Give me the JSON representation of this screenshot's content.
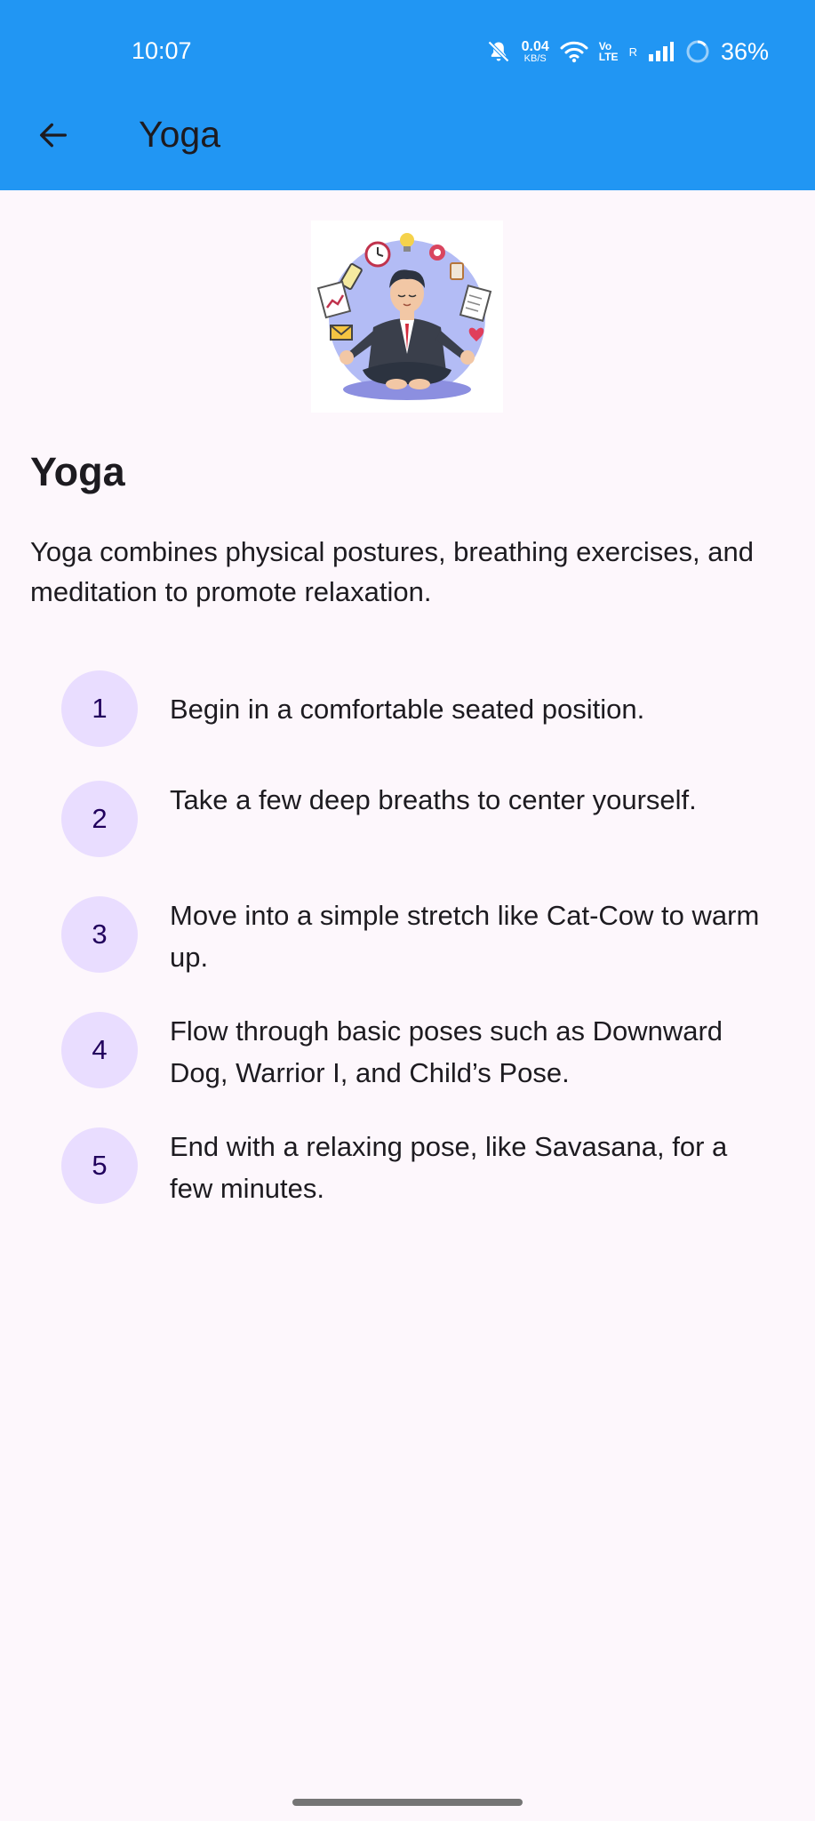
{
  "status_bar": {
    "time": "10:07",
    "net_speed_value": "0.04",
    "net_speed_unit": "KB/S",
    "volte_top": "Vo",
    "volte_bottom": "LTE",
    "roaming": "R",
    "battery": "36%",
    "icons": [
      "mute-bell-icon",
      "wifi-icon",
      "signal-icon",
      "battery-icon"
    ]
  },
  "app_bar": {
    "title": "Yoga",
    "color": "#2196f3",
    "back_icon": "arrow-left-icon"
  },
  "content": {
    "heading": "Yoga",
    "description": "Yoga combines physical postures, breathing exercises, and meditation to promote relaxation.",
    "steps": [
      {
        "number": "1",
        "text": "Begin in a comfortable seated position."
      },
      {
        "number": "2",
        "text": "Take a few deep breaths to center yourself."
      },
      {
        "number": "3",
        "text": "Move into a simple stretch like Cat-Cow to warm up."
      },
      {
        "number": "4",
        "text": "Flow through basic poses such as Downward Dog, Warrior I, and Child’s Pose."
      },
      {
        "number": "5",
        "text": "End with a relaxing pose, like Savasana, for a few minutes."
      }
    ]
  },
  "colors": {
    "background": "#fdf7fc",
    "step_circle": "#e9ddff",
    "step_number": "#21005d"
  }
}
